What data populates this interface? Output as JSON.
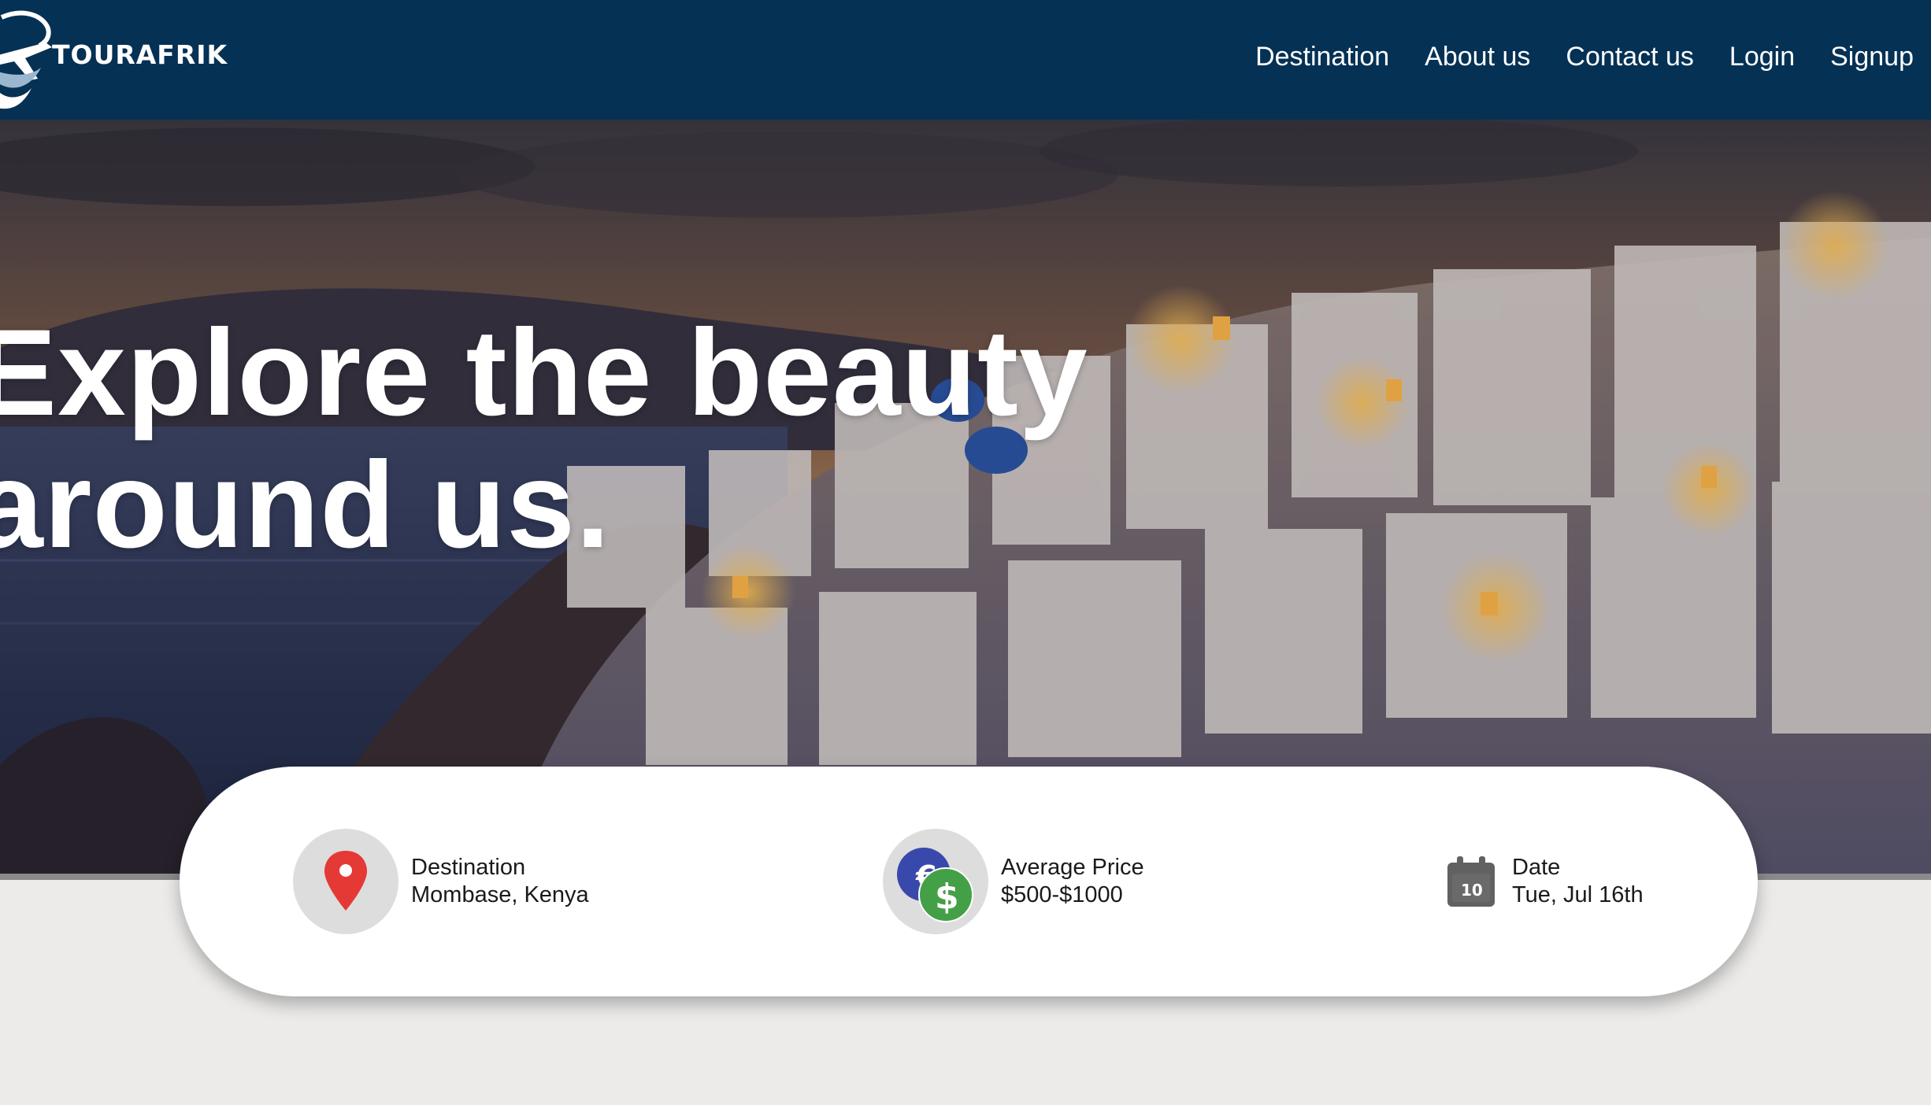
{
  "brand": {
    "name": "TOURAFRIK"
  },
  "nav": {
    "items": [
      {
        "label": "Destination"
      },
      {
        "label": "About us"
      },
      {
        "label": "Contact us"
      },
      {
        "label": "Login"
      },
      {
        "label": "Signup"
      }
    ]
  },
  "hero": {
    "title_line1": "Explore the beauty",
    "title_line2": "around us."
  },
  "search": {
    "destination": {
      "label": "Destination",
      "value": "Mombase, Kenya",
      "icon": "map-pin-icon"
    },
    "price": {
      "label": "Average Price",
      "value": "$500-$1000",
      "icon": "currency-icon"
    },
    "date": {
      "label": "Date",
      "value": "Tue, Jul 16th",
      "icon": "calendar-icon",
      "calendar_day": "10"
    }
  },
  "colors": {
    "navbar": "#043154",
    "pin": "#e53935",
    "euro": "#3949ab",
    "dollar": "#43a047",
    "calendar": "#616161"
  }
}
